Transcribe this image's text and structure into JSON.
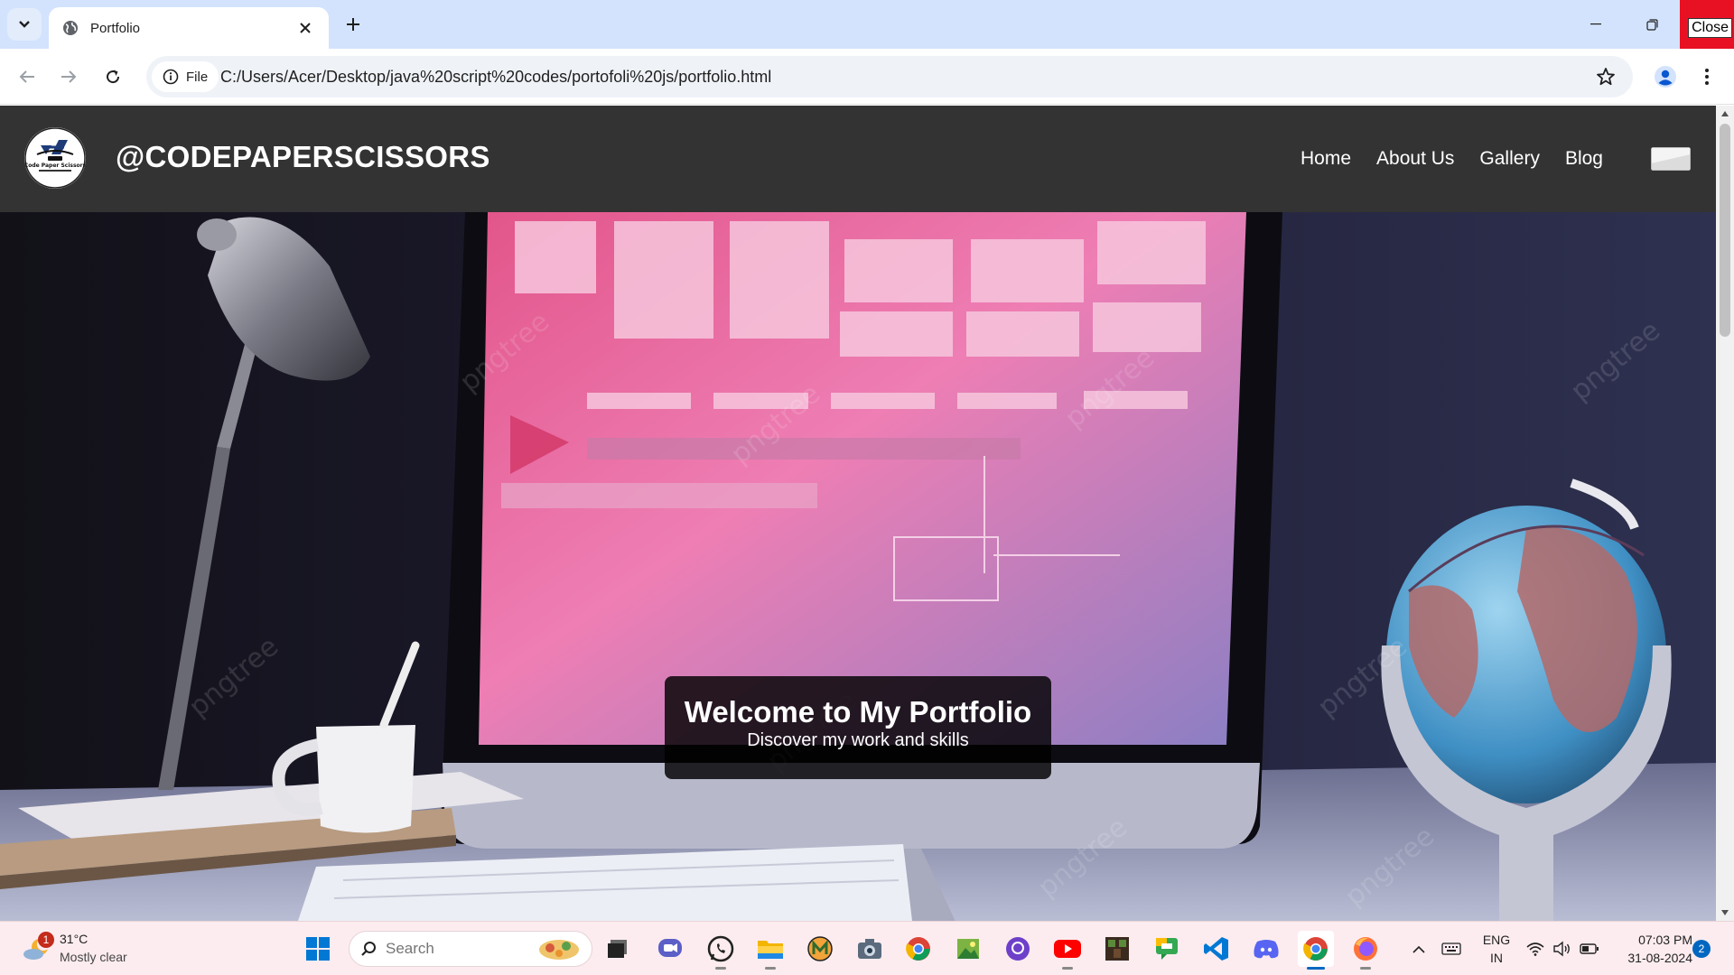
{
  "browser": {
    "tab_title": "Portfolio",
    "close_label": "Close",
    "site_info_label": "File",
    "url": "C:/Users/Acer/Desktop/java%20script%20codes/portofoli%20js/portfolio.html"
  },
  "site": {
    "brand": "@CODEPAPERSCISSORS",
    "logo_text": "Code Paper Scissors",
    "nav": [
      "Home",
      "About Us",
      "Gallery",
      "Blog"
    ],
    "header_bg": "#333333"
  },
  "hero": {
    "title": "Welcome to My Portfolio",
    "subtitle": "Discover my work and skills",
    "watermark": "pngtree"
  },
  "taskbar": {
    "weather_badge": "1",
    "temperature": "31°C",
    "condition": "Mostly clear",
    "search_placeholder": "Search",
    "lang_line1": "ENG",
    "lang_line2": "IN",
    "time": "07:03 PM",
    "date": "31-08-2024",
    "notification_count": "2",
    "apps": [
      "start-icon",
      "search",
      "task-view-icon",
      "meet-icon",
      "whatsapp-icon",
      "file-explorer-icon",
      "mail-app-icon",
      "camera-icon",
      "chrome-icon",
      "photos-icon",
      "github-icon",
      "youtube-icon",
      "minecraft-icon",
      "google-chat-icon",
      "vscode-icon",
      "discord-icon",
      "chrome-icon",
      "firefox-icon"
    ]
  }
}
